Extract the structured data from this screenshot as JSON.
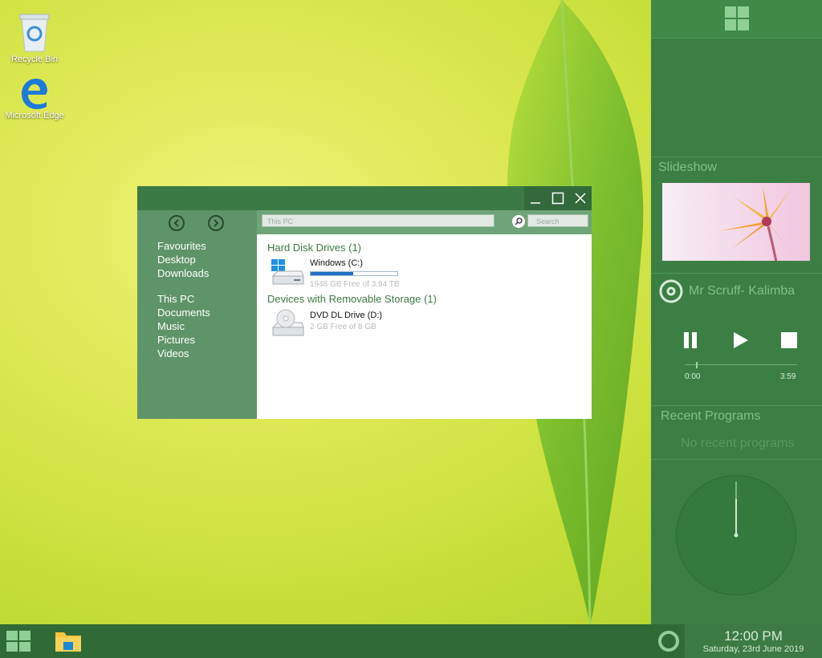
{
  "desktop": {
    "icons": [
      {
        "label": "Recycle Bin"
      },
      {
        "label": "Microsoft Edge"
      }
    ]
  },
  "explorer": {
    "address": "This PC",
    "search_placeholder": "Search",
    "sidebar": {
      "favourites": [
        "Favourites",
        "Desktop",
        "Downloads"
      ],
      "this_pc": [
        "This PC",
        "Documents",
        "Music",
        "Pictures",
        "Videos"
      ]
    },
    "groups": [
      {
        "title": "Hard Disk Drives (1)",
        "drive": {
          "name": "Windows (C:)",
          "free": "1948 GB Free of 3.94 TB",
          "used_fraction": 0.49
        }
      },
      {
        "title": "Devices with Removable Storage (1)",
        "drive": {
          "name": "DVD DL Drive (D:)",
          "free": "2 GB Free of 8 GB"
        }
      }
    ]
  },
  "sidebar_panel": {
    "slideshow_title": "Slideshow",
    "track": "Mr Scruff- Kalimba",
    "time_start": "0:00",
    "time_end": "3:59",
    "progress_fraction": 0.1,
    "recent_title": "Recent Programs",
    "recent_empty": "No recent programs"
  },
  "taskbar": {
    "time": "12:00 PM",
    "date": "Saturday, 23rd June 2019"
  },
  "colors": {
    "accent": "#3c7a45",
    "sidebar": "#3b7f44",
    "taskbar": "#2f6b37",
    "progress": "#1f6fc4"
  },
  "icons": [
    "windows-logo-icon",
    "recycle-bin-icon",
    "edge-icon",
    "file-explorer-icon",
    "cortana-icon",
    "drive-icon",
    "dvd-icon",
    "music-disc-icon",
    "pause-icon",
    "play-icon",
    "stop-icon",
    "back-icon",
    "forward-icon",
    "search-icon",
    "minimize-icon",
    "maximize-icon",
    "close-icon"
  ]
}
